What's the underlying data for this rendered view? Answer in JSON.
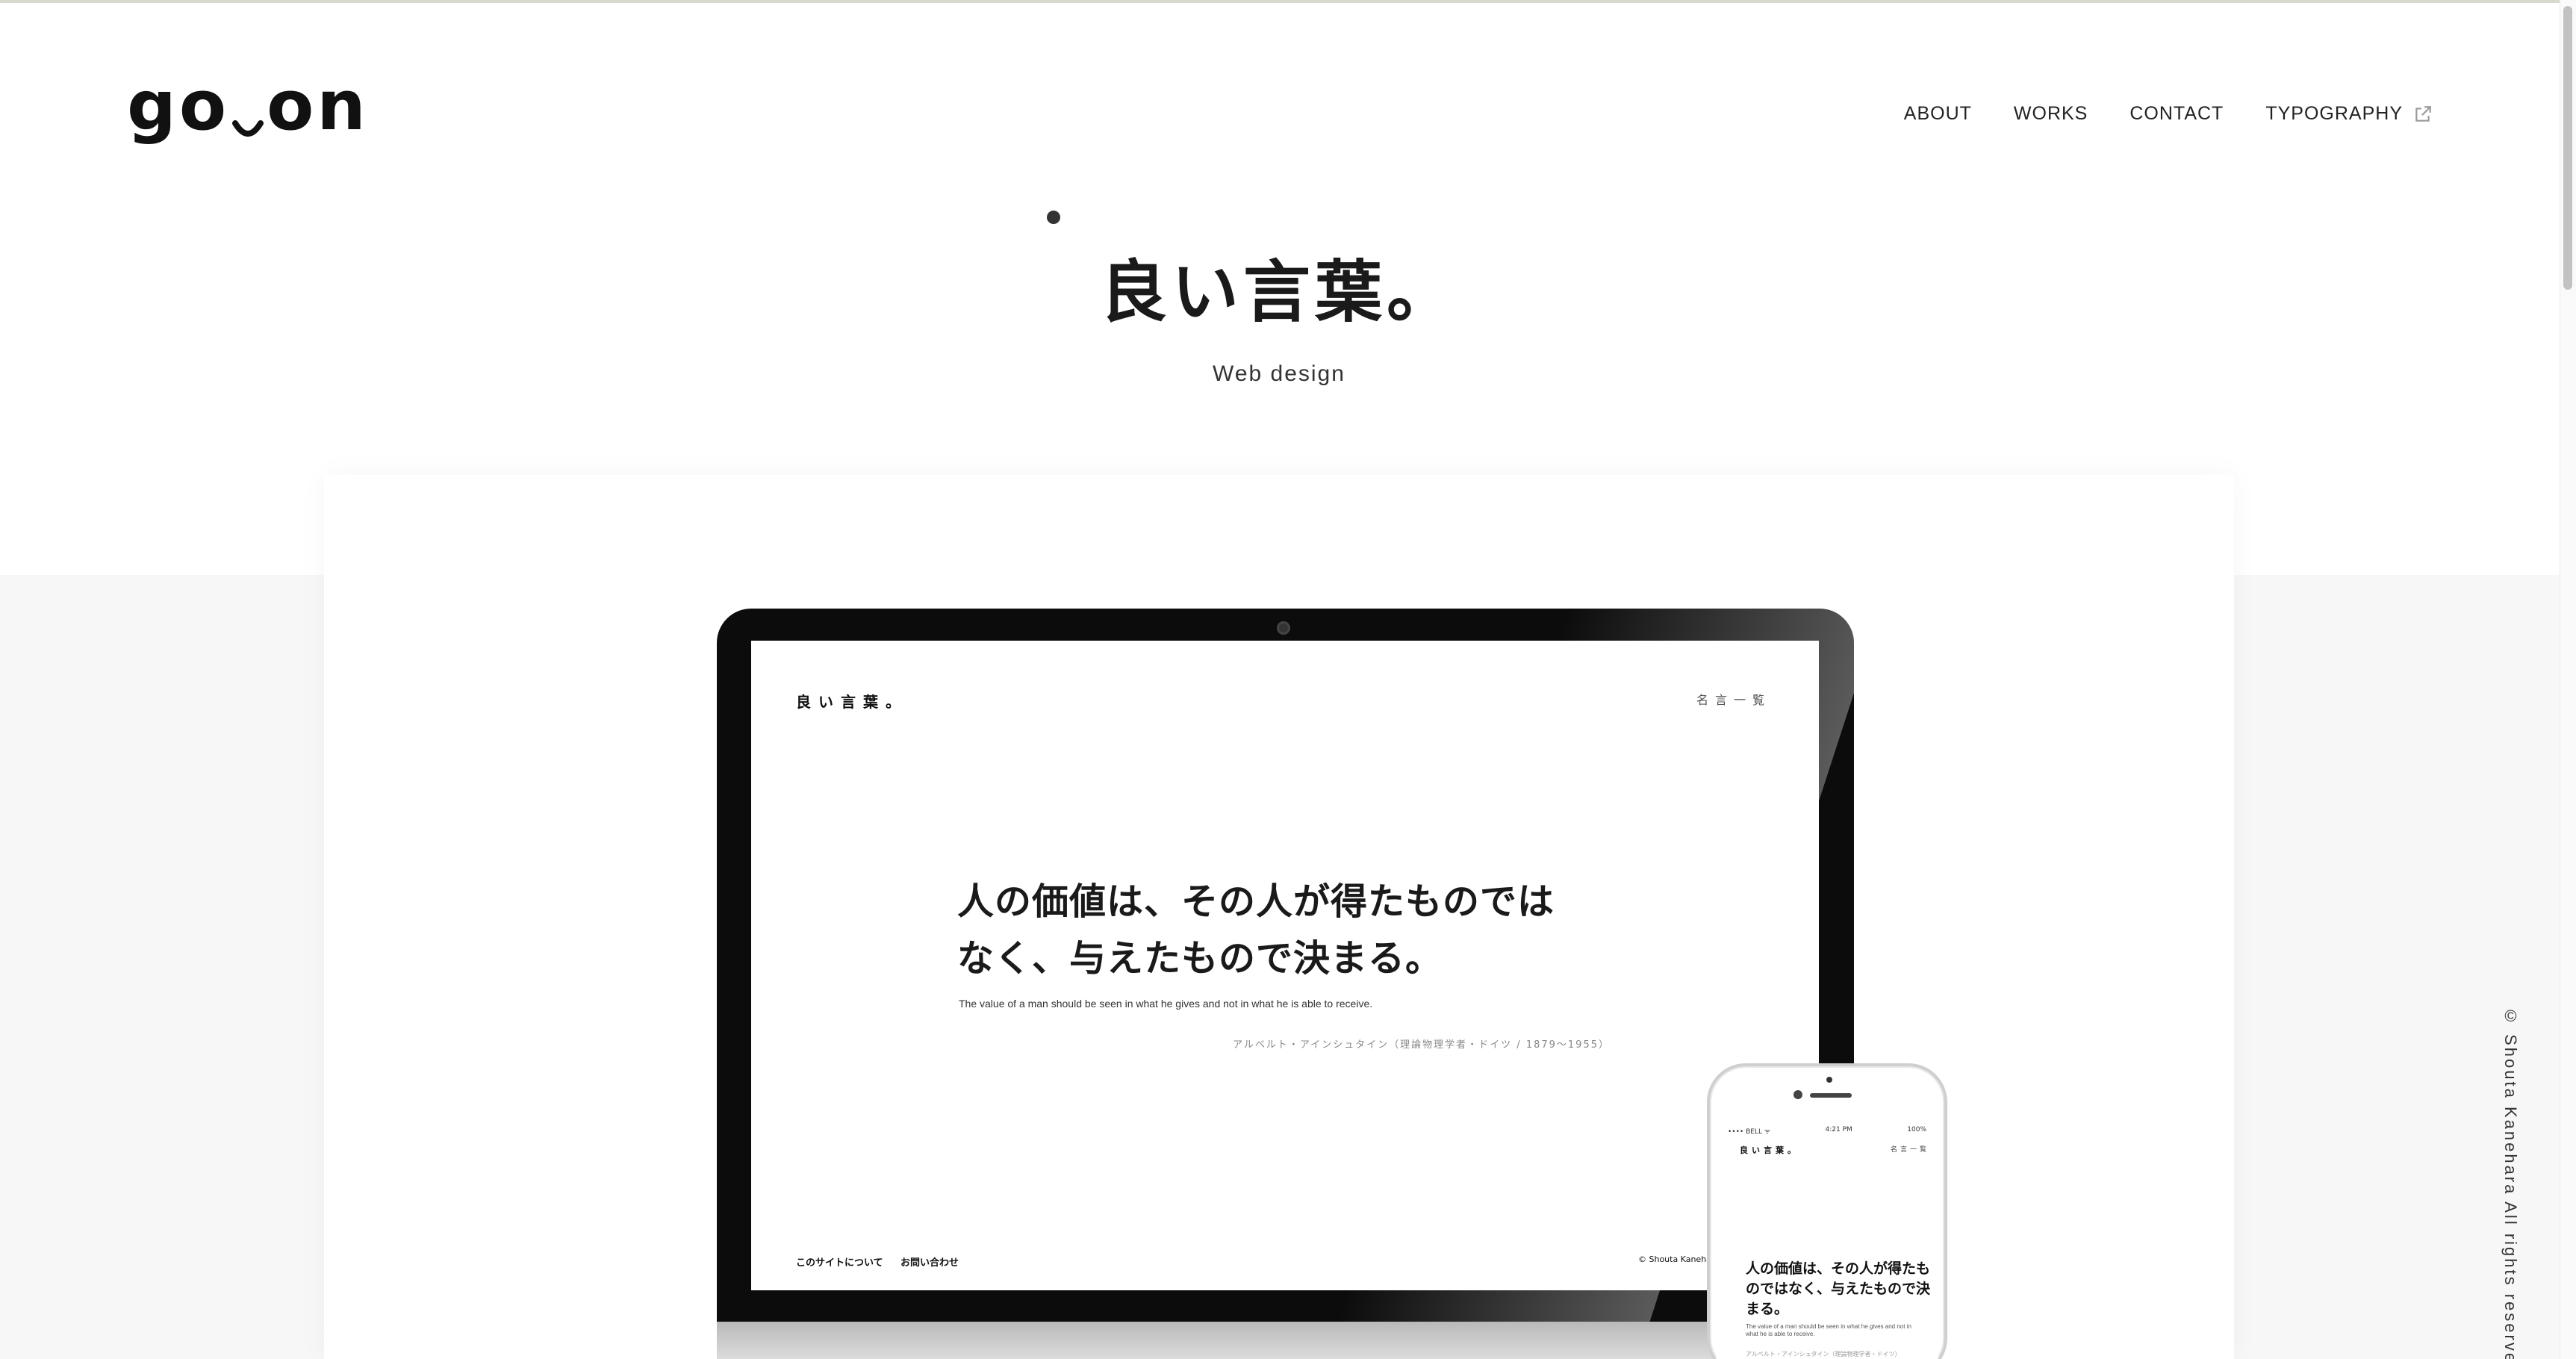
{
  "header": {
    "logo": "go_on",
    "nav": [
      {
        "label": "ABOUT"
      },
      {
        "label": "WORKS"
      },
      {
        "label": "CONTACT"
      },
      {
        "label": "TYPOGRAPHY",
        "icon": "external-link-icon"
      }
    ]
  },
  "work": {
    "title": "良い言葉。",
    "category": "Web design"
  },
  "laptop_screen": {
    "brand": "良い言葉。",
    "list_link": "名言一覧",
    "quote_line1": "人の価値は、その人が得たものでは",
    "quote_line2": "なく、与えたもので決まる。",
    "quote_en": "The value of a man should be seen in what he gives and not in what he is able to receive.",
    "author": "アルベルト・アインシュタイン（理論物理学者・ドイツ / 1879〜1955）",
    "footer_about": "このサイトについて",
    "footer_contact": "お問い合わせ",
    "copyright": "© Shouta Kanehara"
  },
  "phone_screen": {
    "status_carrier": "•••• BELL ᯤ",
    "status_time": "4:21 PM",
    "status_battery": "100%",
    "brand": "良い言葉。",
    "list_link": "名言一覧",
    "quote": "人の価値は、その人が得たものではなく、与えたもので決まる。",
    "quote_en": "The value of a man should be seen in what he gives and not in what he is able to receive.",
    "author": "アルベルト・アインシュタイン（理論物理学者・ドイツ）"
  },
  "footer": {
    "copyright": "© Shouta Kanehara All rights reserved."
  },
  "colors": {
    "text": "#1a1a1a",
    "band": "#f7f7f7",
    "laptop_bezel": "#0c0c0c"
  }
}
